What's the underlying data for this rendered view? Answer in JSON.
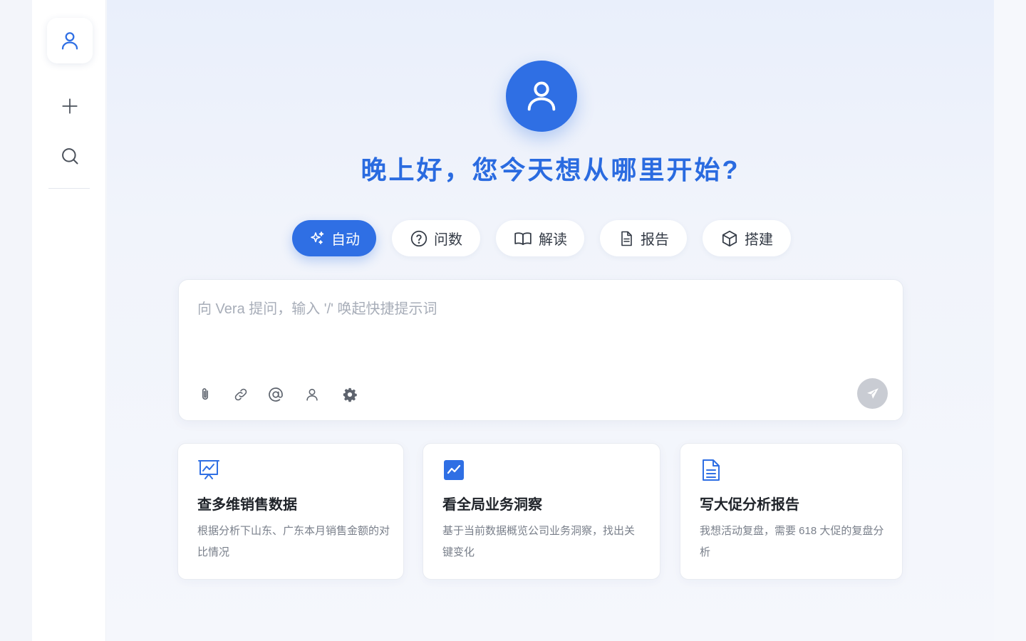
{
  "colors": {
    "accent": "#2f6fe4",
    "send_disabled": "#c9ccd3"
  },
  "sidebar": {
    "avatar_icon": "user-icon",
    "new_icon": "plus-icon",
    "search_icon": "search-icon"
  },
  "hero": {
    "avatar_icon": "user-icon",
    "greeting": "晚上好，您今天想从哪里开始?"
  },
  "modes": [
    {
      "label": "自动",
      "icon": "sparkle-icon",
      "active": true
    },
    {
      "label": "问数",
      "icon": "question-circle-icon",
      "active": false
    },
    {
      "label": "解读",
      "icon": "book-icon",
      "active": false
    },
    {
      "label": "报告",
      "icon": "document-icon",
      "active": false
    },
    {
      "label": "搭建",
      "icon": "cube-icon",
      "active": false
    }
  ],
  "input": {
    "placeholder": "向 Vera 提问，输入 '/' 唤起快捷提示词",
    "value": "",
    "tools": [
      "attachment-icon",
      "link-icon",
      "at-icon",
      "user-icon",
      "settings-icon"
    ],
    "send_icon": "send-icon"
  },
  "cards": [
    {
      "icon": "presentation-chart-icon",
      "title": "查多维销售数据",
      "desc": "根据分析下山东、广东本月销售金额的对比情况"
    },
    {
      "icon": "trend-chart-icon",
      "title": "看全局业务洞察",
      "desc": "基于当前数据概览公司业务洞察，找出关键变化"
    },
    {
      "icon": "document-icon",
      "title": "写大促分析报告",
      "desc": "我想活动复盘，需要 618 大促的复盘分析"
    }
  ]
}
